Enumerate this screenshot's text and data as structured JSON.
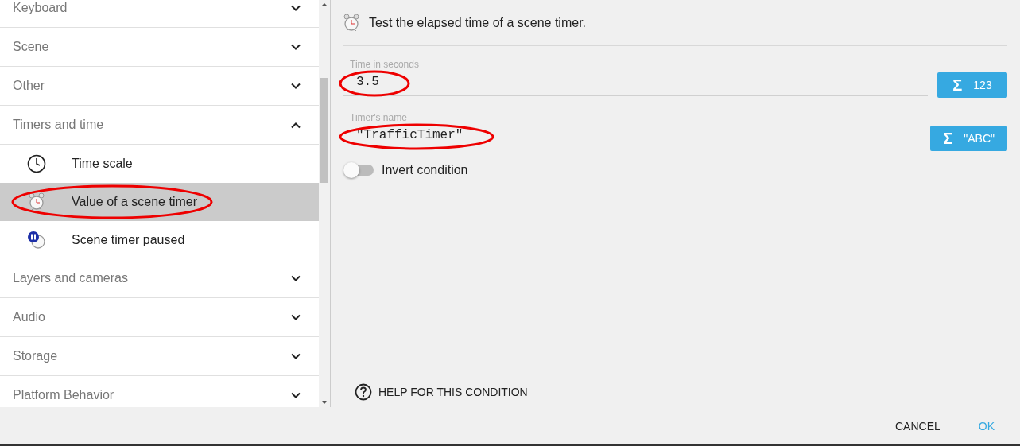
{
  "sidebar": {
    "categories": [
      {
        "label": "Keyboard",
        "expanded": false
      },
      {
        "label": "Scene",
        "expanded": false
      },
      {
        "label": "Other",
        "expanded": false
      },
      {
        "label": "Timers and time",
        "expanded": true,
        "children": [
          {
            "label": "Time scale",
            "kind": "clock",
            "selected": false
          },
          {
            "label": "Value of a scene timer",
            "kind": "timer",
            "selected": true
          },
          {
            "label": "Scene timer paused",
            "kind": "paused",
            "selected": false
          }
        ]
      },
      {
        "label": "Layers and cameras",
        "expanded": false
      },
      {
        "label": "Audio",
        "expanded": false
      },
      {
        "label": "Storage",
        "expanded": false
      },
      {
        "label": "Platform Behavior",
        "expanded": false
      }
    ]
  },
  "condition": {
    "description": "Test the elapsed time of a scene timer.",
    "fields": [
      {
        "label": "Time in seconds",
        "value": "3.5",
        "button_icon": "Σ",
        "button": "123"
      },
      {
        "label": "Timer's name",
        "value": "\"TrafficTimer\"",
        "button_icon": "Σ",
        "button": "\"ABC\""
      }
    ],
    "invert": {
      "label": "Invert condition",
      "on": false
    },
    "help": "HELP FOR THIS CONDITION"
  },
  "buttons": [
    {
      "label": "CANCEL",
      "primary": false
    },
    {
      "label": "OK",
      "primary": true
    }
  ]
}
